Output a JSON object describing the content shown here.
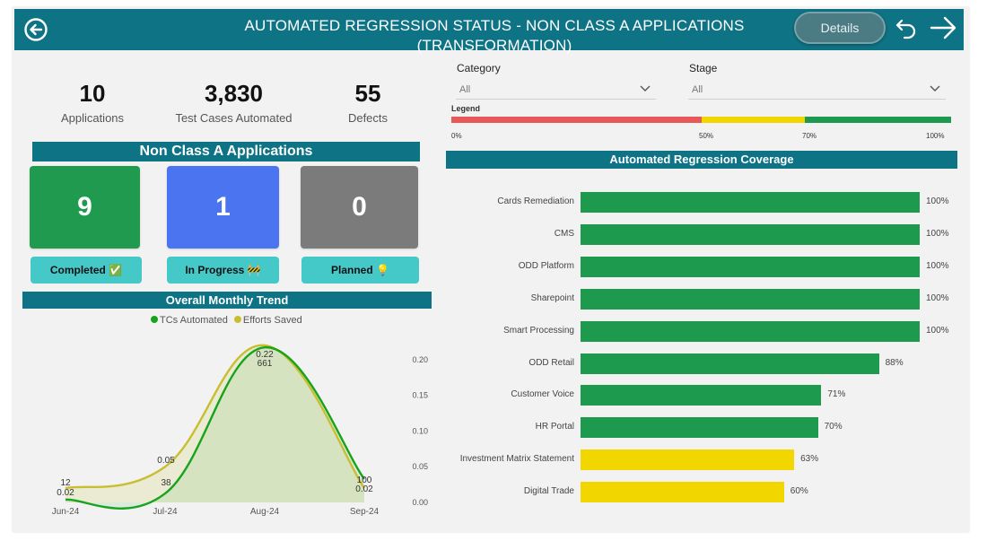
{
  "header": {
    "title": "AUTOMATED REGRESSION STATUS - NON CLASS A APPLICATIONS (TRANSFORMATION)",
    "details_label": "Details"
  },
  "kpis": [
    {
      "value": "10",
      "label": "Applications"
    },
    {
      "value": "3,830",
      "label": "Test Cases Automated"
    },
    {
      "value": "55",
      "label": "Defects"
    }
  ],
  "status_section": {
    "title": "Non Class A Applications",
    "cards": [
      {
        "value": "9",
        "label": "Completed",
        "emoji": "✅",
        "color": "#1f9a4f"
      },
      {
        "value": "1",
        "label": "In Progress",
        "emoji": "🚧",
        "color": "#4a74f0"
      },
      {
        "value": "0",
        "label": "Planned",
        "emoji": "💡",
        "color": "#7b7b7b"
      }
    ]
  },
  "filters": {
    "category": {
      "label": "Category",
      "value": "All"
    },
    "stage": {
      "label": "Stage",
      "value": "All"
    }
  },
  "coverage_legend": {
    "title": "Legend",
    "ticks": [
      "0%",
      "50%",
      "70%",
      "100%"
    ],
    "bands": [
      {
        "from": 0,
        "to": 50,
        "color": "#e85858"
      },
      {
        "from": 50,
        "to": 70,
        "color": "#f2d600"
      },
      {
        "from": 70,
        "to": 100,
        "color": "#1e9a4f"
      }
    ]
  },
  "colors": {
    "header": "#0e7384",
    "green": "#1e9a4f",
    "yellow": "#f2d600",
    "red": "#e85858",
    "tcs_line": "#17a31c",
    "efforts_line": "#c8be32"
  },
  "chart_data": [
    {
      "type": "line",
      "title": "Overall Monthly Trend",
      "x": [
        "Jun-24",
        "Jul-24",
        "Aug-24",
        "Sep-24"
      ],
      "series": [
        {
          "name": "TCs Automated",
          "values": [
            12,
            38,
            661,
            100
          ],
          "labels": [
            "12",
            "38",
            "661",
            "100"
          ],
          "axis": "left-hidden",
          "ylim": [
            0,
            700
          ]
        },
        {
          "name": "Efforts Saved",
          "values": [
            0.02,
            0.05,
            0.22,
            0.02
          ],
          "labels": [
            "0.02",
            "0.05",
            "0.22",
            "0.02"
          ],
          "axis": "right",
          "ylim": [
            0,
            0.23
          ]
        }
      ],
      "y2_ticks": [
        "0.00",
        "0.05",
        "0.10",
        "0.15",
        "0.20"
      ],
      "legend": "top-center",
      "area_fill": true
    },
    {
      "type": "bar",
      "orientation": "horizontal",
      "title": "Automated Regression Coverage",
      "categories": [
        "Cards Remediation",
        "CMS",
        "ODD Platform",
        "Sharepoint",
        "Smart Processing",
        "ODD Retail",
        "Customer Voice",
        "HR Portal",
        "Investment Matrix Statement",
        "Digital Trade"
      ],
      "values": [
        100,
        100,
        100,
        100,
        100,
        88,
        71,
        70,
        63,
        60
      ],
      "value_labels": [
        "100%",
        "100%",
        "100%",
        "100%",
        "100%",
        "88%",
        "71%",
        "70%",
        "63%",
        "60%"
      ],
      "xlim": [
        0,
        100
      ]
    }
  ]
}
